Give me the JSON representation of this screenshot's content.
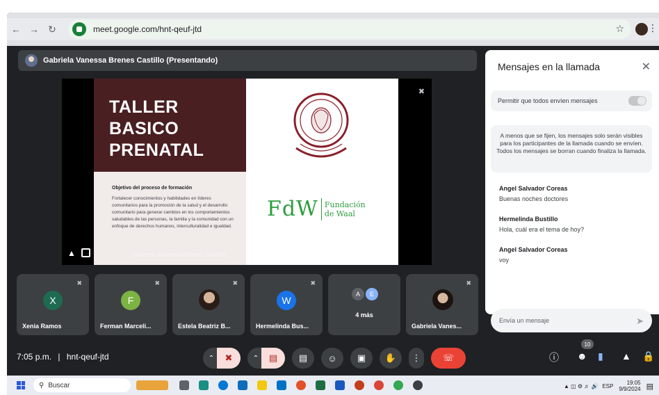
{
  "browser": {
    "url": "meet.google.com/hnt-qeuf-jtd"
  },
  "presenter": {
    "label": "Gabriela Vanessa Brenes Castillo (Presentando)"
  },
  "slide": {
    "title_lines": [
      "TALLER",
      "BASICO",
      "PRENATAL"
    ],
    "objective_title": "Objetivo del proceso de formación",
    "objective_text": "Fortalecer conocimientos y habilidades en líderes comunitarios para la promoción de la salud y el desarrollo comunitario para generar cambios en los comportamientos saludables de las personas, la familia y la comunidad con un enfoque de derechos humanos, interculturalidad e igualdad.",
    "logo_letters": "FdW",
    "logo_text_1": "Fundación",
    "logo_text_2": "de Waal",
    "watermark": "Gabriela Vanessa Brenes Castillo"
  },
  "participants": [
    {
      "name": "Xenia Ramos",
      "initial": "X",
      "color": "#1e6b52"
    },
    {
      "name": "Ferman Marceli...",
      "initial": "F",
      "color": "#7cb342"
    },
    {
      "name": "Estela Beatriz B...",
      "initial": "",
      "color": ""
    },
    {
      "name": "Hermelinda Bus...",
      "initial": "W",
      "color": "#1a73e8"
    },
    {
      "name": "",
      "initial": "",
      "color": ""
    },
    {
      "name": "Gabriela Vanes...",
      "initial": "",
      "color": ""
    }
  ],
  "more": {
    "initials": [
      "A",
      "E"
    ],
    "label": "4 más"
  },
  "chat": {
    "title": "Mensajes en la llamada",
    "toggle_label": "Permitir que todos envíen mensajes",
    "notice": "A menos que se fijen, los mensajes solo serán visibles para los participantes de la llamada cuando se envíen. Todos los mensajes se borran cuando finaliza la llamada.",
    "messages": [
      {
        "author": "Angel Salvador Coreas",
        "text": "Buenas noches doctores"
      },
      {
        "author": "Hermelinda Bustillo",
        "text": "Hola, cuál era el tema de hoy?"
      },
      {
        "author": "Angel Salvador Coreas",
        "text": "voy"
      }
    ],
    "input_placeholder": "Envía un mensaje"
  },
  "controls": {
    "time": "7:05 p.m.",
    "separator": "|",
    "meeting_code": "hnt-qeuf-jtd",
    "people_count": "10"
  },
  "taskbar": {
    "search_label": "Buscar",
    "lang": "ESP",
    "time": "19:05",
    "date": "9/9/2024"
  }
}
